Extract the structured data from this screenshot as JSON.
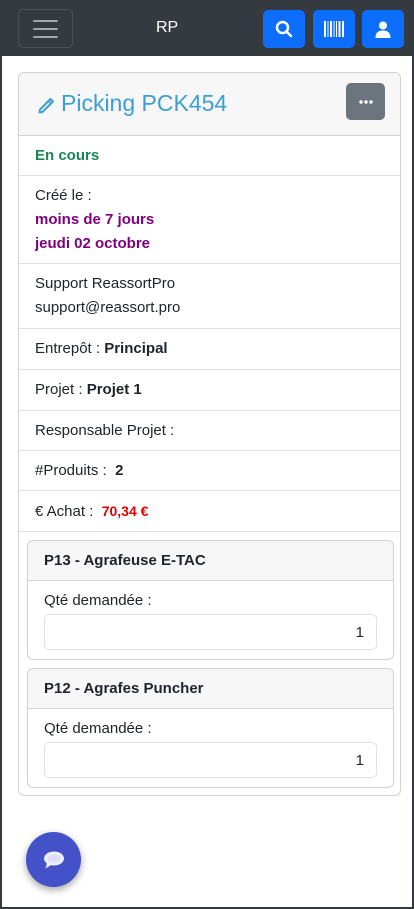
{
  "navbar": {
    "brand": "RP",
    "icons": [
      "menu-icon",
      "search-icon",
      "barcode-icon",
      "user-icon"
    ],
    "accent": "#0d6efd",
    "background": "#343a40"
  },
  "picking": {
    "title": "Picking PCK454",
    "status": "En cours",
    "created_label": "Créé le :",
    "created_relative": "moins de 7 jours",
    "created_date": "jeudi 02 octobre",
    "contact_name": "Support ReassortPro",
    "contact_email": "support@reassort.pro",
    "warehouse_label": "Entrepôt :",
    "warehouse_value": "Principal",
    "project_label": "Projet :",
    "project_value": "Projet 1",
    "manager_label": "Responsable Projet :",
    "products_label": "#Produits :",
    "products_value": "2",
    "purchase_label": "€ Achat :",
    "purchase_value": "70,34 €"
  },
  "products": [
    {
      "name": "P13 - Agrafeuse E-TAC",
      "qty_label": "Qté demandée :",
      "qty_value": "1"
    },
    {
      "name": "P12 - Agrafes Puncher",
      "qty_label": "Qté demandée :",
      "qty_value": "1"
    }
  ],
  "colors": {
    "title": "#3c9ed4",
    "status": "#198754",
    "date": "#800080",
    "price": "#e00000",
    "chat": "#4352c8"
  }
}
